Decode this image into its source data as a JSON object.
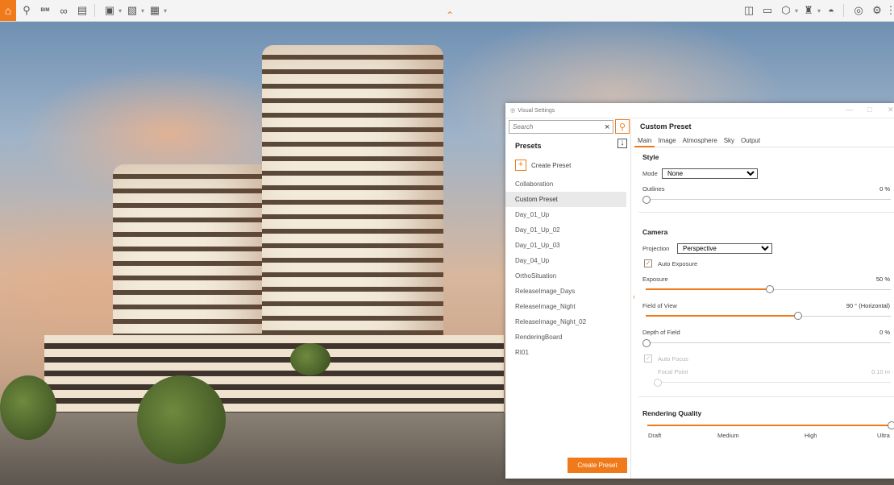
{
  "toolbar": {
    "left_icons": [
      "home-icon",
      "location-pin-icon",
      "bim-icon",
      "binoculars-icon",
      "clapperboard-icon",
      "screenshot-icon",
      "image-export-icon",
      "video-export-icon"
    ],
    "bim_label": "BIM",
    "right_icons": [
      "book-icon",
      "monitor-icon",
      "cube-icon",
      "people-icon",
      "helmet-icon",
      "visual-settings-icon",
      "gear-icon"
    ]
  },
  "panel": {
    "window_title": "Visual Settings",
    "search_placeholder": "Search",
    "presets_heading": "Presets",
    "create_preset_link": "Create Preset",
    "presets": [
      "Collaboration",
      "Custom Preset",
      "Day_01_Up",
      "Day_01_Up_02",
      "Day_01_Up_03",
      "Day_04_Up",
      "OrthoSituation",
      "ReleaseImage_Days",
      "ReleaseImage_Night",
      "ReleaseImage_Night_02",
      "RenderingBoard",
      "RI01"
    ],
    "selected_preset": "Custom Preset",
    "create_preset_button": "Create Preset",
    "preset_title": "Custom Preset",
    "tabs": [
      "Main",
      "Image",
      "Atmosphere",
      "Sky",
      "Output"
    ],
    "active_tab": "Main",
    "style": {
      "heading": "Style",
      "mode_label": "Mode",
      "mode_value": "None",
      "outlines_label": "Outlines",
      "outlines_value": "0 %",
      "outlines_level": 0
    },
    "camera": {
      "heading": "Camera",
      "projection_label": "Projection",
      "projection_value": "Perspective",
      "auto_exposure_label": "Auto Exposure",
      "auto_exposure_checked": true,
      "exposure_label": "Exposure",
      "exposure_value": "50 %",
      "exposure_level": 0.5,
      "fov_label": "Field of View",
      "fov_value": "90 ° (Horizontal)",
      "fov_level": 0.62,
      "dof_label": "Depth of Field",
      "dof_value": "0 %",
      "dof_level": 0,
      "auto_focus_label": "Auto Focus",
      "focal_point_label": "Focal Point",
      "focal_point_value": "0.10 m"
    },
    "rendering_quality": {
      "heading": "Rendering Quality",
      "levels": [
        "Draft",
        "Medium",
        "High",
        "Ultra"
      ],
      "selected": "Ultra"
    }
  },
  "colors": {
    "accent": "#f07a1a"
  }
}
